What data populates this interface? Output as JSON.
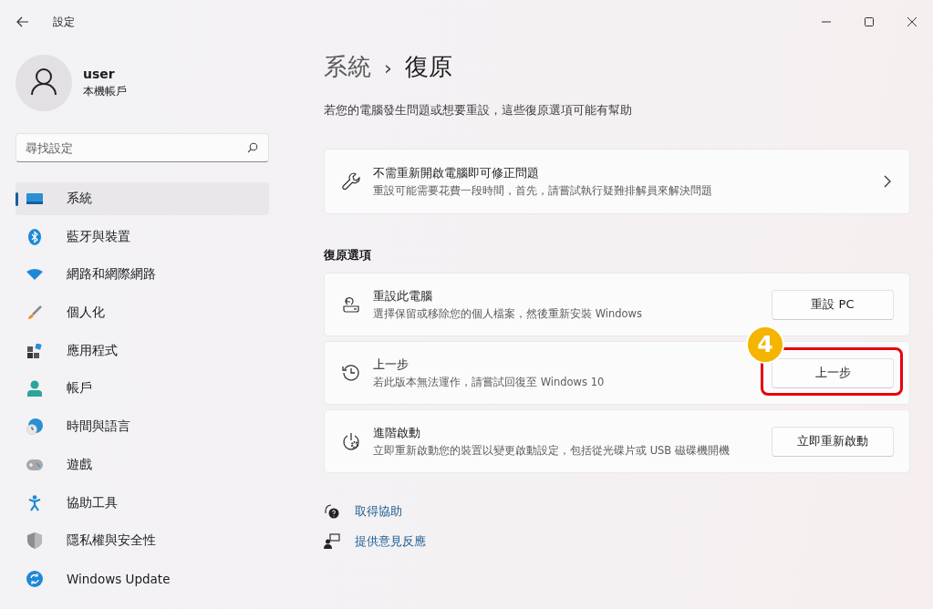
{
  "window": {
    "title": "設定"
  },
  "account": {
    "name": "user",
    "type": "本機帳戶"
  },
  "search": {
    "placeholder": "尋找設定"
  },
  "nav": [
    {
      "label": "系統",
      "selected": true
    },
    {
      "label": "藍牙與裝置",
      "selected": false
    },
    {
      "label": "網路和網際網路",
      "selected": false
    },
    {
      "label": "個人化",
      "selected": false
    },
    {
      "label": "應用程式",
      "selected": false
    },
    {
      "label": "帳戶",
      "selected": false
    },
    {
      "label": "時間與語言",
      "selected": false
    },
    {
      "label": "遊戲",
      "selected": false
    },
    {
      "label": "協助工具",
      "selected": false
    },
    {
      "label": "隱私權與安全性",
      "selected": false
    },
    {
      "label": "Windows Update",
      "selected": false
    }
  ],
  "breadcrumb": {
    "parent": "系統",
    "separator": "›",
    "current": "復原"
  },
  "subtitle": "若您的電腦發生問題或想要重設，這些復原選項可能有幫助",
  "fix_card": {
    "title": "不需重新開啟電腦即可修正問題",
    "description": "重設可能需要花費一段時間，首先，請嘗試執行疑難排解員來解決問題"
  },
  "section_label": "復原選項",
  "options": [
    {
      "title": "重設此電腦",
      "description": "選擇保留或移除您的個人檔案，然後重新安裝 Windows",
      "button": "重設 PC",
      "highlighted": false
    },
    {
      "title": "上一步",
      "description": "若此版本無法運作，請嘗試回復至 Windows 10",
      "button": "上一步",
      "highlighted": true
    },
    {
      "title": "進階啟動",
      "description": "立即重新啟動您的裝置以變更啟動設定，包括從光碟片或 USB 磁碟機開機",
      "button": "立即重新啟動",
      "highlighted": false
    }
  ],
  "step_badge": "4",
  "links": [
    "取得協助",
    "提供意見反應"
  ]
}
